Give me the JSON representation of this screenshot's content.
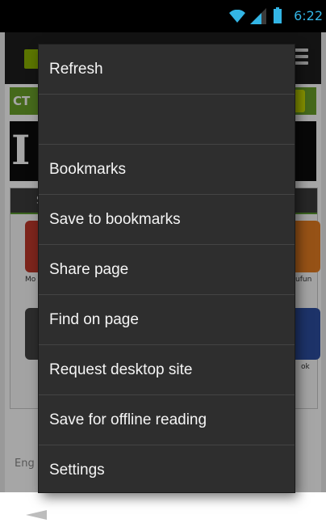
{
  "status_bar": {
    "time": "6:22",
    "icons": [
      "wifi-icon",
      "signal-icon",
      "battery-icon"
    ],
    "accent_color": "#33b5e5"
  },
  "browser": {
    "site_header": {
      "text": "CT"
    },
    "banner_glyph": "I",
    "card": {
      "header_text": "S",
      "tiles": [
        {
          "label": "Mo",
          "color": "#c0392b"
        },
        {
          "label": "llufun",
          "color": "#e67e22"
        },
        {
          "label": "",
          "color": "#444444"
        },
        {
          "label": "ok",
          "color": "#2d4fa1"
        }
      ]
    },
    "footer_text": "Eng"
  },
  "menu": {
    "background": "#2e2e2e",
    "items": [
      {
        "label": "Refresh"
      },
      {
        "label": ""
      },
      {
        "label": "Bookmarks"
      },
      {
        "label": "Save to bookmarks"
      },
      {
        "label": "Share page"
      },
      {
        "label": "Find on page"
      },
      {
        "label": "Request desktop site"
      },
      {
        "label": "Save for offline reading"
      },
      {
        "label": "Settings"
      }
    ]
  }
}
